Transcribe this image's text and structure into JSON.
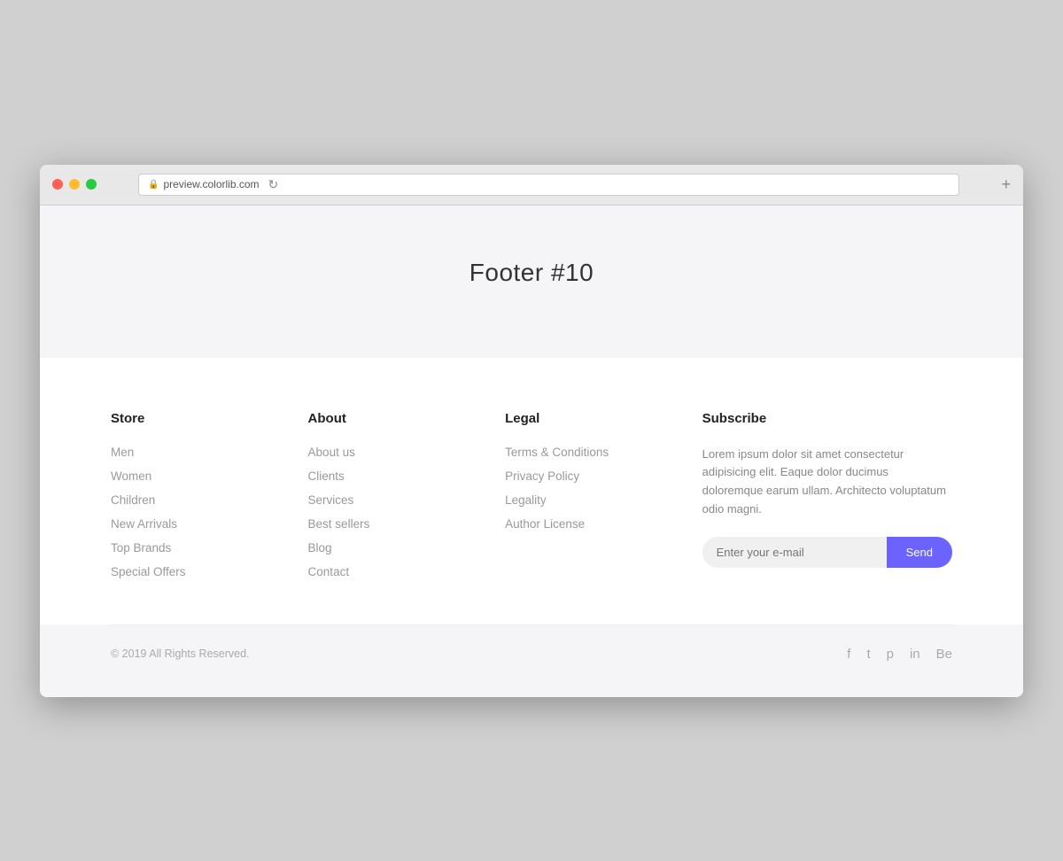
{
  "browser": {
    "url": "preview.colorlib.com",
    "new_tab_icon": "+"
  },
  "hero": {
    "title": "Footer #10"
  },
  "footer": {
    "store": {
      "heading": "Store",
      "links": [
        "Men",
        "Women",
        "Children",
        "New Arrivals",
        "Top Brands",
        "Special Offers"
      ]
    },
    "about": {
      "heading": "About",
      "links": [
        "About us",
        "Clients",
        "Services",
        "Best sellers",
        "Blog",
        "Contact"
      ]
    },
    "legal": {
      "heading": "Legal",
      "links": [
        "Terms & Conditions",
        "Privacy Policy",
        "Legality",
        "Author License"
      ]
    },
    "subscribe": {
      "heading": "Subscribe",
      "description": "Lorem ipsum dolor sit amet consectetur adipisicing elit. Eaque dolor ducimus doloremque earum ullam. Architecto voluptatum odio magni.",
      "input_placeholder": "Enter your e-mail",
      "send_label": "Send"
    },
    "bottom": {
      "copyright": "© 2019 All Rights Reserved.",
      "social": [
        "f",
        "t",
        "p",
        "in",
        "Be"
      ]
    }
  }
}
